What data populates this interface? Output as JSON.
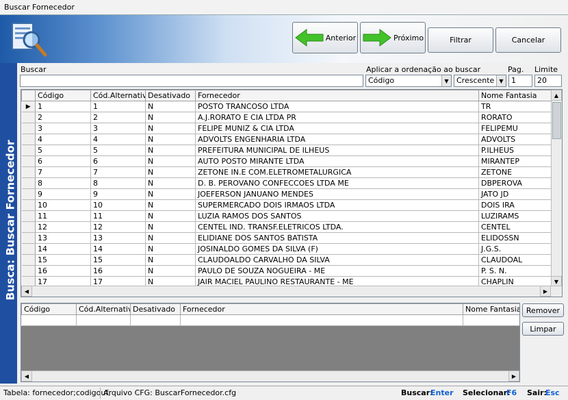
{
  "window": {
    "title": "Buscar Fornecedor"
  },
  "toolbar": {
    "anterior": "Anterior",
    "proximo": "Próximo",
    "filtrar": "Filtrar",
    "cancelar": "Cancelar"
  },
  "sidebar": {
    "label": "Busca:  Buscar Fornecedor"
  },
  "search": {
    "label": "Buscar",
    "value": ""
  },
  "order": {
    "label": "Aplicar a ordenação ao buscar",
    "field": "Código",
    "direction": "Crescente"
  },
  "pag": {
    "label": "Pag.",
    "value": "1"
  },
  "limite": {
    "label": "Limite",
    "value": "20"
  },
  "grid": {
    "columns": [
      "Código",
      "Cód.Alternativo",
      "Desativado",
      "Fornecedor",
      "Nome Fantasia"
    ],
    "rows": [
      [
        "1",
        "1",
        "N",
        "POSTO TRANCOSO LTDA",
        "TR"
      ],
      [
        "2",
        "2",
        "N",
        "A.J.RORATO E CIA LTDA PR",
        "RORATO"
      ],
      [
        "3",
        "3",
        "N",
        "FELIPE MUNIZ & CIA LTDA",
        "FELIPEMU"
      ],
      [
        "4",
        "4",
        "N",
        "ADVOLTS ENGENHARIA LTDA",
        "ADVOLTS"
      ],
      [
        "5",
        "5",
        "N",
        "PREFEITURA MUNICIPAL DE ILHEUS",
        "P.ILHEUS"
      ],
      [
        "6",
        "6",
        "N",
        "AUTO POSTO MIRANTE LTDA",
        "MIRANTEP"
      ],
      [
        "7",
        "7",
        "N",
        "ZETONE IN.E COM.ELETROMETALURGICA",
        "ZETONE"
      ],
      [
        "8",
        "8",
        "N",
        "D. B. PEROVANO CONFECCOES LTDA ME",
        "DBPEROVA"
      ],
      [
        "9",
        "9",
        "N",
        "JOEFERSON JANUANO MENDES",
        "JATO JD"
      ],
      [
        "10",
        "10",
        "N",
        "SUPERMERCADO DOIS IRMAOS LTDA",
        "DOIS IRA"
      ],
      [
        "11",
        "11",
        "N",
        "LUZIA RAMOS DOS SANTOS",
        "LUZIRAMS"
      ],
      [
        "12",
        "12",
        "N",
        "CENTEL IND. TRANSF.ELETRICOS LTDA.",
        "CENTEL"
      ],
      [
        "13",
        "13",
        "N",
        "ELIDIANE DOS SANTOS BATISTA",
        "ELIDOSSN"
      ],
      [
        "14",
        "14",
        "N",
        "JOSINALDO GOMES DA SILVA (F)",
        "J.G.S."
      ],
      [
        "15",
        "15",
        "N",
        "CLAUDOALDO CARVALHO DA SILVA",
        "CLAUDOAL"
      ],
      [
        "16",
        "16",
        "N",
        "PAULO DE SOUZA NOGUEIRA - ME",
        "P. S. N."
      ],
      [
        "17",
        "17",
        "N",
        "JAIR MACIEL PAULINO RESTAURANTE - ME",
        "CHAPLIN"
      ]
    ]
  },
  "selected": {
    "columns": [
      "Código",
      "Cód.Alternativo",
      "Desativado",
      "Fornecedor",
      "Nome Fantasia"
    ]
  },
  "side_buttons": {
    "remover": "Remover",
    "limpar": "Limpar"
  },
  "status": {
    "tabela": "Tabela: fornecedor;codigouf;",
    "arquivo": "Arquivo CFG: BuscarFornecedor.cfg",
    "buscar_label": "Buscar:",
    "buscar_key": "Enter",
    "selecionar_label": "Selecionar:",
    "selecionar_key": "F6",
    "sair_label": "Sair:",
    "sair_key": "Esc"
  }
}
